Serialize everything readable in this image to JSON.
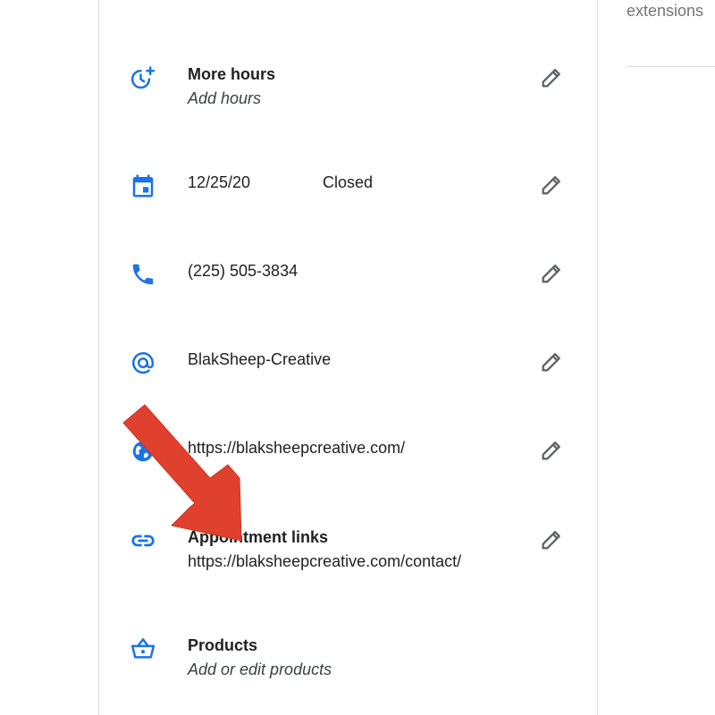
{
  "colors": {
    "icon_blue": "#1a73e8",
    "pencil_gray": "#5f6368",
    "arrow_red": "#e0412f"
  },
  "right_panel": {
    "label": "extensions"
  },
  "rows": [
    {
      "icon": "schedule-add-icon",
      "title": "More hours",
      "subtitle": "Add hours"
    },
    {
      "icon": "calendar-icon",
      "date": "12/25/20",
      "status": "Closed"
    },
    {
      "icon": "phone-icon",
      "value": "(225) 505-3834"
    },
    {
      "icon": "at-sign-icon",
      "value": "BlakSheep-Creative"
    },
    {
      "icon": "globe-icon",
      "value": "https://blaksheepcreative.com/"
    },
    {
      "icon": "link-icon",
      "title": "Appointment links",
      "value": "https://blaksheepcreative.com/contact/"
    },
    {
      "icon": "basket-icon",
      "title": "Products",
      "subtitle": "Add or edit products"
    }
  ],
  "annotation": {
    "icon": "red-arrow-icon"
  }
}
